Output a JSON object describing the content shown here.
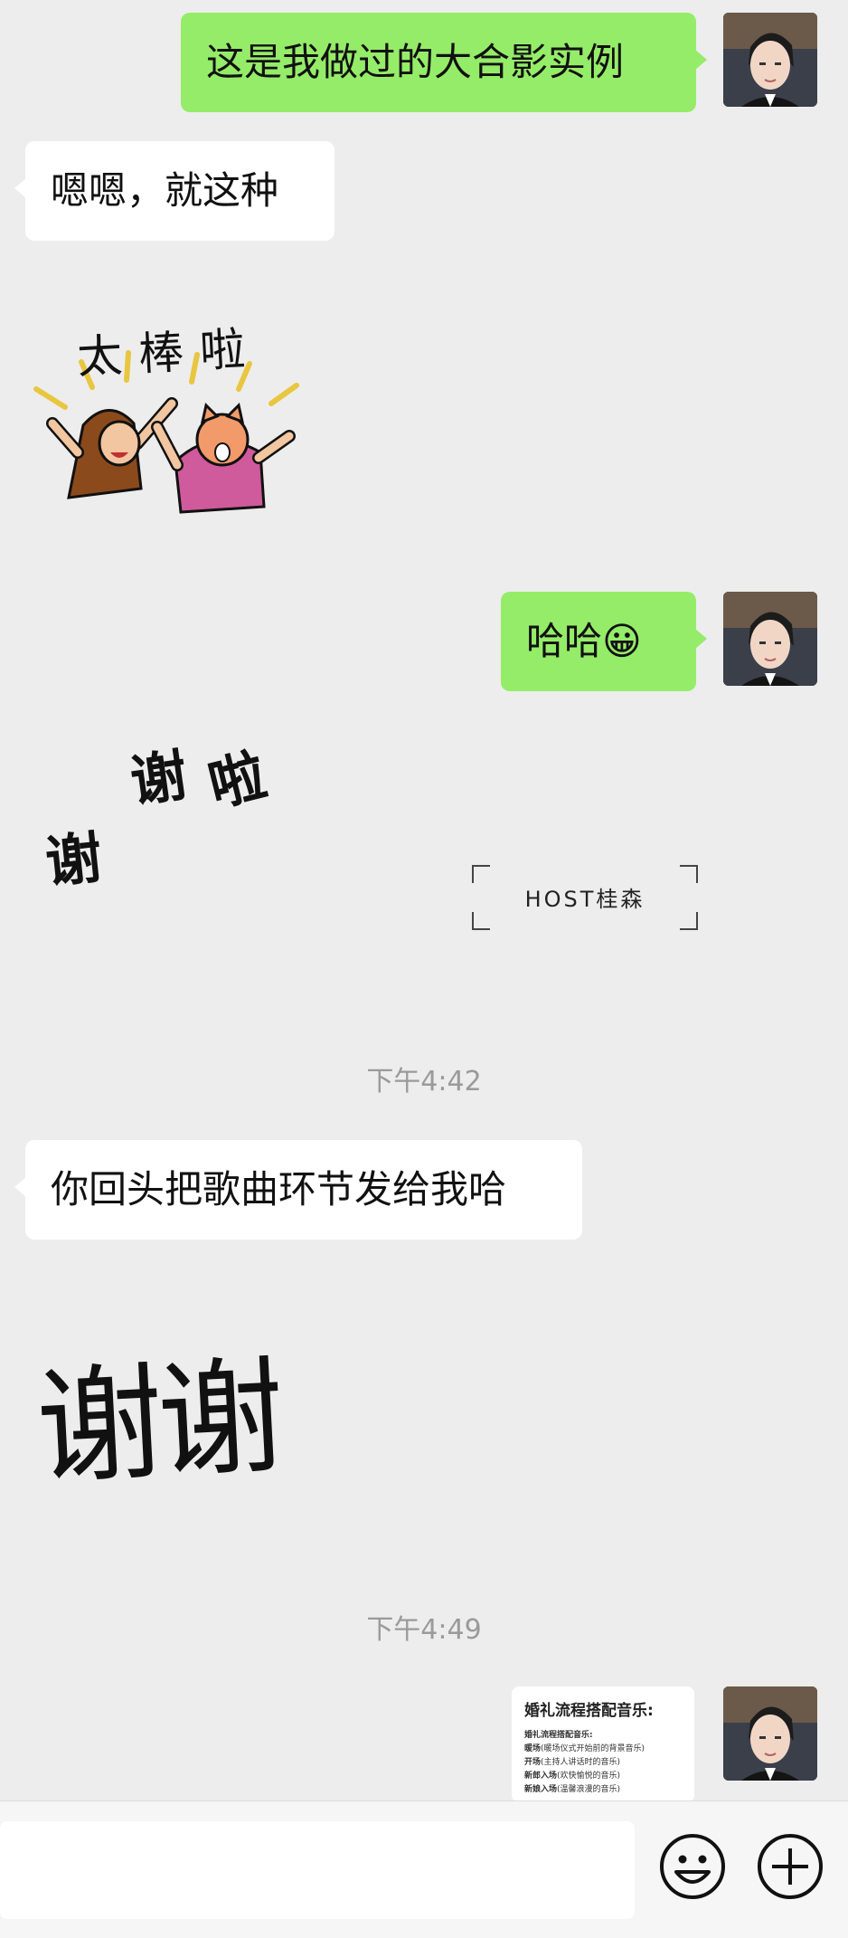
{
  "messages": [
    {
      "side": "right",
      "type": "text",
      "text": "这是我做过的大合影实例"
    },
    {
      "side": "left",
      "type": "text",
      "text": "嗯嗯，就这种"
    },
    {
      "side": "left",
      "type": "sticker",
      "text": "太棒啦"
    },
    {
      "side": "right",
      "type": "text",
      "text": "哈哈",
      "emoji": "😀"
    },
    {
      "side": "left",
      "type": "sticker",
      "text_1": "谢",
      "text_2": "谢",
      "text_3": "啦"
    },
    {
      "type": "timestamp",
      "text": "下午4:42"
    },
    {
      "side": "left",
      "type": "text",
      "text": "你回头把歌曲环节发给我哈"
    },
    {
      "side": "left",
      "type": "sticker",
      "text": "谢谢"
    },
    {
      "type": "timestamp",
      "text": "下午4:49"
    },
    {
      "side": "right",
      "type": "document",
      "title": "婚礼流程搭配音乐:",
      "lines": [
        {
          "bold": "婚礼流程搭配音乐:",
          "rest": ""
        },
        {
          "bold": "暖场",
          "rest": "(暖场仪式开始前的背景音乐)"
        },
        {
          "bold": "开场",
          "rest": "(主持人讲话时的音乐)"
        },
        {
          "bold": "新郎入场",
          "rest": "(欢快愉悦的音乐)"
        },
        {
          "bold": "新娘入场",
          "rest": "(温馨浪漫的音乐)"
        }
      ]
    }
  ],
  "watermark": {
    "text": "HOST桂森"
  },
  "input_bar": {
    "emoji_icon": "smile-icon",
    "plus_icon": "plus-circle-icon"
  },
  "colors": {
    "sent_bubble": "#95ec69",
    "received_bubble": "#ffffff",
    "background": "#ededed"
  }
}
